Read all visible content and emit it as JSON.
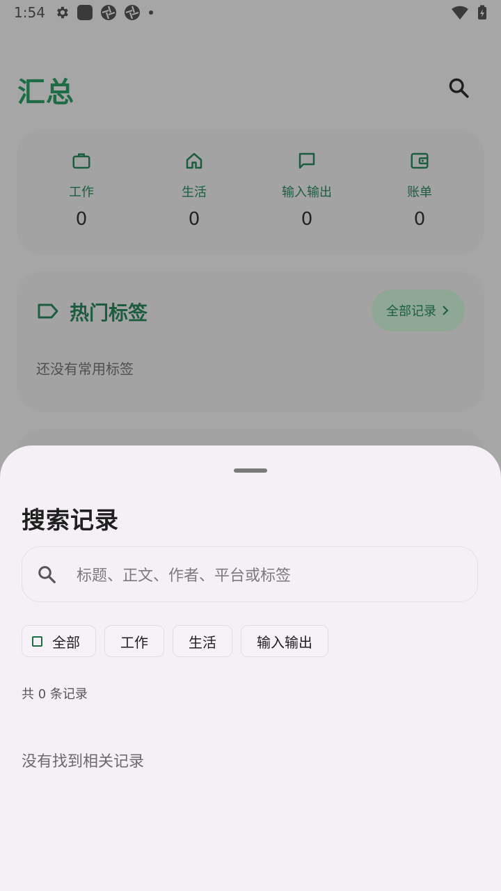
{
  "status_bar": {
    "time": "1:54",
    "left_icons": [
      "gear-icon",
      "app-square-icon",
      "aperture-icon",
      "aperture-icon",
      "dot-icon"
    ],
    "right_icons": [
      "wifi-icon",
      "battery-charging-icon"
    ]
  },
  "header": {
    "title": "汇总",
    "search_icon": "search-icon"
  },
  "summary": {
    "items": [
      {
        "icon": "briefcase-icon",
        "label": "工作",
        "value": "0"
      },
      {
        "icon": "home-icon",
        "label": "生活",
        "value": "0"
      },
      {
        "icon": "chat-icon",
        "label": "输入输出",
        "value": "0"
      },
      {
        "icon": "wallet-icon",
        "label": "账单",
        "value": "0"
      }
    ]
  },
  "hot_tags": {
    "icon": "tag-icon",
    "title": "热门标签",
    "all_records_label": "全部记录",
    "empty_text": "还没有常用标签"
  },
  "sheet": {
    "title": "搜索记录",
    "search": {
      "placeholder": "标题、正文、作者、平台或标签",
      "value": ""
    },
    "filters": [
      {
        "label": "全部",
        "selected": true
      },
      {
        "label": "工作",
        "selected": false
      },
      {
        "label": "生活",
        "selected": false
      },
      {
        "label": "输入输出",
        "selected": false
      }
    ],
    "count_text": "共 0 条记录",
    "empty_text": "没有找到相关记录"
  },
  "colors": {
    "accent": "#1d6c46",
    "sheet_bg": "#f4f0f6",
    "scrim": "#a6a6a6"
  }
}
